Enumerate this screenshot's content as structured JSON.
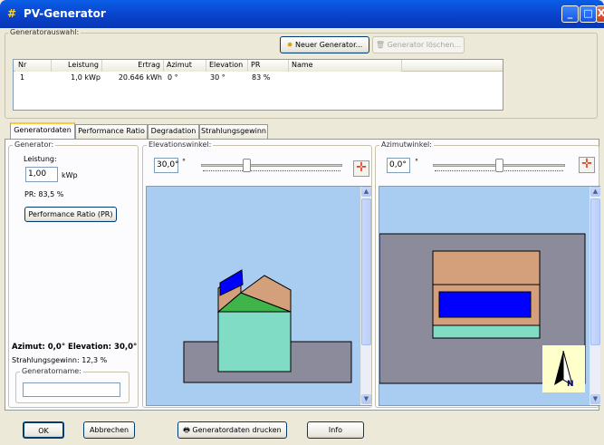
{
  "window": {
    "title": "PV-Generator",
    "controls": [
      "_",
      "□",
      "X"
    ]
  },
  "generator_selection": {
    "group_label": "Generatorauswahl:",
    "new_button": "Neuer Generator...",
    "delete_button": "Generator löschen...",
    "columns": [
      "Nr",
      "Leistung",
      "Ertrag",
      "Azimut",
      "Elevation",
      "PR",
      "Name"
    ],
    "rows": [
      {
        "nr": "1",
        "leistung": "1,0 kWp",
        "ertrag": "20.646 kWh",
        "azimut": "0 °",
        "elevation": "30 °",
        "pr": "83 %",
        "name": ""
      }
    ]
  },
  "tabs": [
    "Generatordaten",
    "Performance Ratio",
    "Degradation",
    "Strahlungsgewinn"
  ],
  "active_tab": 0,
  "generator": {
    "group_label": "Generator:",
    "leistung_label": "Leistung:",
    "leistung_value": "1,00",
    "unit": "kWp",
    "pr_text": "PR: 83,5 %",
    "pr_button": "Performance Ratio (PR)",
    "summary": "Azimut: 0,0°  Elevation: 30,0°",
    "gain_text": "Strahlungsgewinn: 12,3 %",
    "name_label": "Generatorname:",
    "name_value": ""
  },
  "elevation": {
    "group_label": "Elevationswinkel:",
    "value": "30,0°",
    "degree": "°"
  },
  "azimuth": {
    "group_label": "Azimutwinkel:",
    "value": "0,0°",
    "degree": "°",
    "compass_letter": "N"
  },
  "footer": {
    "ok": "OK",
    "cancel": "Abbrechen",
    "print": "Generatordaten drucken",
    "info": "Info"
  },
  "colors": {
    "sky": "#a9cdf0",
    "ground": "#8b8b9b",
    "roof": "#d4a07c",
    "house": "#80dcc4",
    "panel": "#0000ff",
    "green_roof": "#3fb44b",
    "compass_bg": "#ffffcc"
  }
}
